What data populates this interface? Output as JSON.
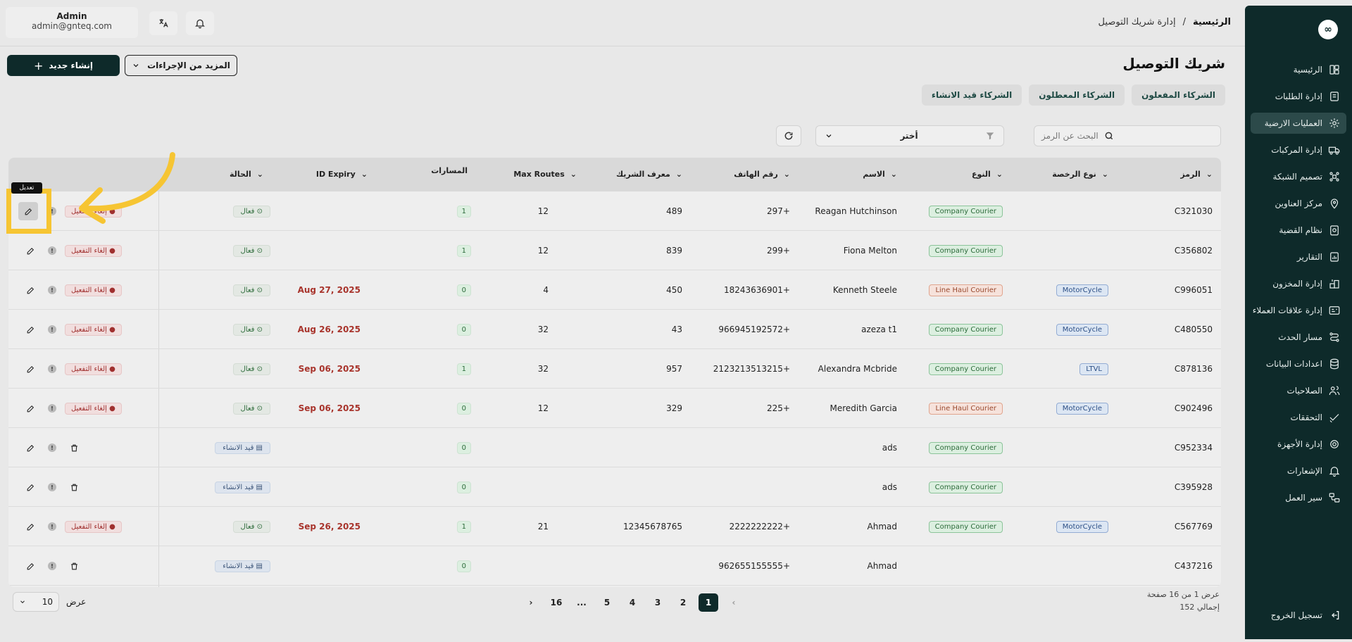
{
  "topbar": {
    "user_name": "Admin",
    "user_email": "admin@gnteq.com",
    "breadcrumb_home": "الرئيسية",
    "breadcrumb_sep": "/",
    "breadcrumb_current": "إدارة شريك التوصيل"
  },
  "sidebar": {
    "logo": "∞",
    "items": [
      {
        "label": "الرئيسية",
        "icon": "dashboard-icon"
      },
      {
        "label": "إدارة الطلبات",
        "icon": "orders-icon"
      },
      {
        "label": "العمليات الارضية",
        "icon": "operations-icon"
      },
      {
        "label": "إدارة المركبات",
        "icon": "truck-icon"
      },
      {
        "label": "تصميم الشبكة",
        "icon": "network-icon"
      },
      {
        "label": "مركز العناوين",
        "icon": "location-icon"
      },
      {
        "label": "نظام القضية",
        "icon": "case-icon"
      },
      {
        "label": "التقارير",
        "icon": "reports-icon"
      },
      {
        "label": "إدارة المخزون",
        "icon": "inventory-icon"
      },
      {
        "label": "إدارة علاقات العملاء",
        "icon": "crm-icon"
      },
      {
        "label": "مسار الحدث",
        "icon": "route-icon"
      },
      {
        "label": "اعدادات البيانات",
        "icon": "database-icon"
      },
      {
        "label": "الصلاحيات",
        "icon": "users-icon"
      },
      {
        "label": "التحققات",
        "icon": "verify-icon"
      },
      {
        "label": "إدارة الأجهزة",
        "icon": "devices-icon"
      },
      {
        "label": "الإشعارات",
        "icon": "bell-icon"
      },
      {
        "label": "سير العمل",
        "icon": "workflow-icon"
      }
    ],
    "logout": "تسجيل الخروج"
  },
  "page": {
    "title": "شريك التوصيل",
    "create_btn": "إنشاء جديد",
    "more_btn": "المزيد من الإجراءات",
    "tabs": [
      "الشركاء المفعلون",
      "الشركاء المعطلون",
      "الشركاء قيد الانشاء"
    ]
  },
  "filters": {
    "search_placeholder": "البحث عن الرمز",
    "select_label": "أختر"
  },
  "table": {
    "headers": {
      "code": "الرمز",
      "license": "نوع الرخصة",
      "type": "النوع",
      "name": "الاسم",
      "phone": "رقم الهاتف",
      "partner_id": "معرف الشريك",
      "max_routes": "Max Routes",
      "routes": "المسارات",
      "id_expiry": "ID Expiry",
      "status": "الحالة"
    },
    "deactivate_label": "إلغاء التفعيل",
    "info_label": "!",
    "rows": [
      {
        "code": "C321030",
        "license": "",
        "type": "Company Courier",
        "type_kind": "company",
        "name": "Reagan Hutchinson",
        "phone": "297+",
        "partner_id": "489",
        "max_routes": "12",
        "routes": "1",
        "expiry": "",
        "status": "فعال",
        "status_kind": "active"
      },
      {
        "code": "C356802",
        "license": "",
        "type": "Company Courier",
        "type_kind": "company",
        "name": "Fiona Melton",
        "phone": "299+",
        "partner_id": "839",
        "max_routes": "12",
        "routes": "1",
        "expiry": "",
        "status": "فعال",
        "status_kind": "active"
      },
      {
        "code": "C996051",
        "license": "MotorCycle",
        "type": "Line Haul Courier",
        "type_kind": "linehaul",
        "name": "Kenneth Steele",
        "phone": "18243636901+",
        "partner_id": "450",
        "max_routes": "4",
        "routes": "0",
        "expiry": "Aug 27, 2025",
        "status": "فعال",
        "status_kind": "active"
      },
      {
        "code": "C480550",
        "license": "MotorCycle",
        "type": "Company Courier",
        "type_kind": "company",
        "name": "azeza t1",
        "phone": "966945192572+",
        "partner_id": "43",
        "max_routes": "32",
        "routes": "0",
        "expiry": "Aug 26, 2025",
        "status": "فعال",
        "status_kind": "active"
      },
      {
        "code": "C878136",
        "license": "LTVL",
        "type": "Company Courier",
        "type_kind": "company",
        "name": "Alexandra Mcbride",
        "phone": "2123213513215+",
        "partner_id": "957",
        "max_routes": "32",
        "routes": "1",
        "expiry": "Sep 06, 2025",
        "status": "فعال",
        "status_kind": "active"
      },
      {
        "code": "C902496",
        "license": "MotorCycle",
        "type": "Line Haul Courier",
        "type_kind": "linehaul",
        "name": "Meredith Garcia",
        "phone": "225+",
        "partner_id": "329",
        "max_routes": "12",
        "routes": "0",
        "expiry": "Sep 06, 2025",
        "status": "فعال",
        "status_kind": "active"
      },
      {
        "code": "C952334",
        "license": "",
        "type": "Company Courier",
        "type_kind": "company",
        "name": "ads",
        "phone": "",
        "partner_id": "",
        "max_routes": "",
        "routes": "0",
        "expiry": "",
        "status": "قيد الانشاء",
        "status_kind": "draft"
      },
      {
        "code": "C395928",
        "license": "",
        "type": "Company Courier",
        "type_kind": "company",
        "name": "ads",
        "phone": "",
        "partner_id": "",
        "max_routes": "",
        "routes": "0",
        "expiry": "",
        "status": "قيد الانشاء",
        "status_kind": "draft"
      },
      {
        "code": "C567769",
        "license": "MotorCycle",
        "type": "Company Courier",
        "type_kind": "company",
        "name": "Ahmad",
        "phone": "2222222222+",
        "partner_id": "12345678765",
        "max_routes": "21",
        "routes": "1",
        "expiry": "Sep 26, 2025",
        "status": "فعال",
        "status_kind": "active"
      },
      {
        "code": "C437216",
        "license": "",
        "type": "",
        "type_kind": "",
        "name": "Ahmad",
        "phone": "962655155555+",
        "partner_id": "",
        "max_routes": "",
        "routes": "0",
        "expiry": "",
        "status": "قيد الانشاء",
        "status_kind": "draft"
      }
    ]
  },
  "pagination": {
    "pages": [
      "1",
      "2",
      "3",
      "4",
      "5",
      "...",
      "16"
    ],
    "current": "1",
    "info_line1": "عرض 1 من 16 صفحة",
    "info_line2": "إجمالي 152",
    "page_size_label": "عرض",
    "page_size": "10"
  },
  "tooltip": "تعديل",
  "colors": {
    "sidebar_bg": "#0e2a2a",
    "highlight": "#f6c533",
    "expiry": "#a8342c"
  }
}
